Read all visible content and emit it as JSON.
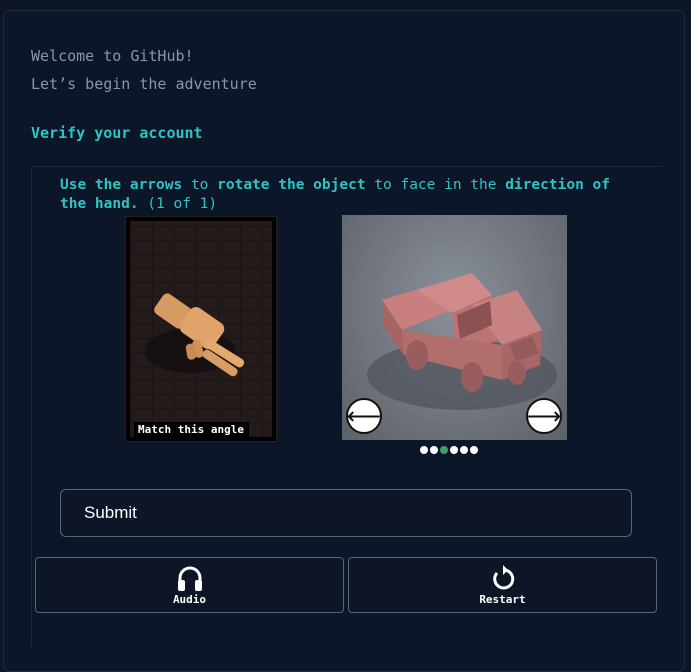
{
  "welcome": {
    "line1": "Welcome to GitHub!",
    "line2": "Let’s begin the adventure"
  },
  "verify_heading": "Verify your account",
  "instruction": {
    "part1": "Use the arrows",
    "part2": " to ",
    "part3": "rotate the object",
    "part4": " to face in the ",
    "part5": "direction of the hand.",
    "part6": " (1 of 1)"
  },
  "reference": {
    "label": "Match this angle"
  },
  "object_view": {
    "prev_icon": "arrow-left-icon",
    "next_icon": "arrow-right-icon",
    "total_dots": 6,
    "active_dot": 3,
    "active_dot_color": "#3fa06a"
  },
  "submit_label": "Submit",
  "bottom_buttons": {
    "audio_label": "Audio",
    "audio_icon": "headphones-icon",
    "restart_label": "Restart",
    "restart_icon": "restart-icon"
  },
  "colors": {
    "background": "#0d1526",
    "accent": "#2ec4c4",
    "muted_text": "#8b95a7"
  }
}
